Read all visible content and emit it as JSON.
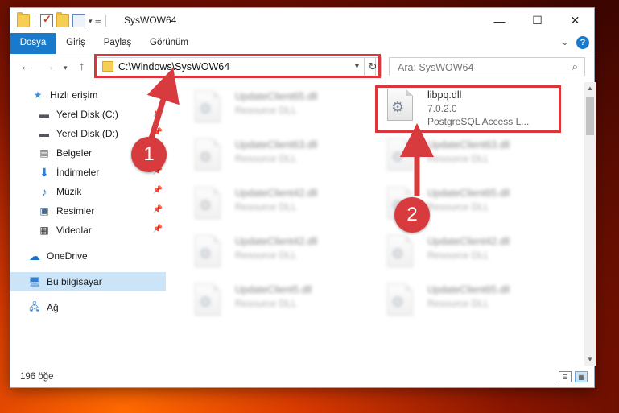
{
  "window": {
    "title": "SysWOW64"
  },
  "ribbon": {
    "tabs": [
      "Dosya",
      "Giriş",
      "Paylaş",
      "Görünüm"
    ]
  },
  "address": {
    "path": "C:\\Windows\\SysWOW64"
  },
  "search": {
    "placeholder": "Ara: SysWOW64"
  },
  "sidebar": {
    "items": [
      {
        "label": "Hızlı erişim",
        "icon": "star-icon",
        "pinned": false
      },
      {
        "label": "Yerel Disk (C:)",
        "icon": "drive-icon",
        "pinned": true
      },
      {
        "label": "Yerel Disk (D:)",
        "icon": "drive-icon",
        "pinned": true
      },
      {
        "label": "Belgeler",
        "icon": "documents-icon",
        "pinned": true
      },
      {
        "label": "İndirmeler",
        "icon": "download-icon",
        "pinned": true
      },
      {
        "label": "Müzik",
        "icon": "music-icon",
        "pinned": true
      },
      {
        "label": "Resimler",
        "icon": "pictures-icon",
        "pinned": true
      },
      {
        "label": "Videolar",
        "icon": "video-icon",
        "pinned": true
      },
      {
        "label": "OneDrive",
        "icon": "cloud-icon",
        "pinned": false
      },
      {
        "label": "Bu bilgisayar",
        "icon": "computer-icon",
        "pinned": false,
        "selected": true
      },
      {
        "label": "Ağ",
        "icon": "network-icon",
        "pinned": false
      }
    ]
  },
  "files": {
    "highlight": {
      "name": "libpq.dll",
      "version": "7.0.2.0",
      "description": "PostgreSQL Access L..."
    },
    "left": [
      {
        "name": "UpdateClient65.dll",
        "desc": "Resource DLL"
      },
      {
        "name": "UpdateClient63.dll",
        "desc": "Resource DLL"
      },
      {
        "name": "UpdateClient42.dll",
        "desc": "Resource DLL"
      },
      {
        "name": "UpdateClient42.dll",
        "desc": "Resource DLL"
      },
      {
        "name": "UpdateClient5.dll",
        "desc": "Resource DLL"
      }
    ],
    "right": [
      {
        "name": "UpdateClient63.dll",
        "desc": "Resource DLL"
      },
      {
        "name": "UpdateClient65.dll",
        "desc": "Resource DLL"
      },
      {
        "name": "UpdateClient42.dll",
        "desc": "Resource DLL"
      },
      {
        "name": "UpdateClient65.dll",
        "desc": "Resource DLL"
      }
    ]
  },
  "status": {
    "count": "196 öğe"
  },
  "annotations": {
    "step1": "1",
    "step2": "2",
    "color": "#d73b3e"
  }
}
